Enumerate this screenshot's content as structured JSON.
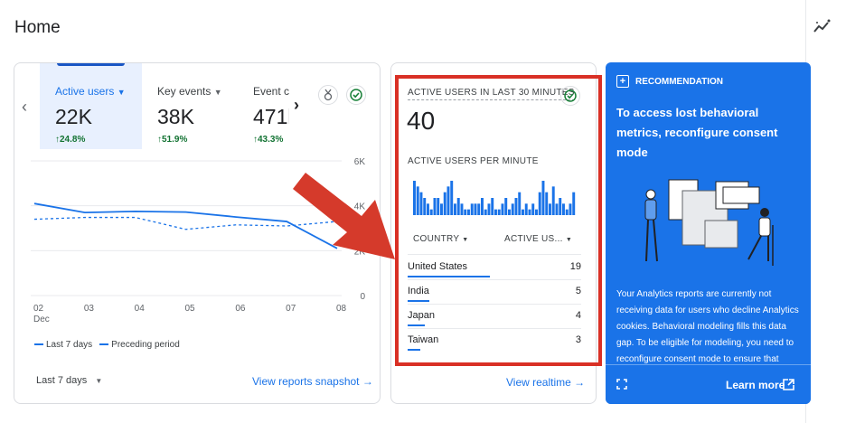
{
  "page": {
    "title": "Home"
  },
  "toolbar": {
    "insights_icon": "insights-icon"
  },
  "overview": {
    "metrics": [
      {
        "label": "Active users",
        "value": "22K",
        "change": "24.8%",
        "selected": true
      },
      {
        "label": "Key events",
        "value": "38K",
        "change": "51.9%",
        "selected": false
      },
      {
        "label": "Event c",
        "value": "471k",
        "change": "43.3%",
        "selected": false
      }
    ],
    "chart_data": {
      "type": "line",
      "x": [
        "02",
        "03",
        "04",
        "05",
        "06",
        "07",
        "08"
      ],
      "x_sublabel": "Dec",
      "ytick_labels": [
        "6K",
        "4K",
        "2K",
        "0"
      ],
      "ylim": [
        0,
        6000
      ],
      "grid": true,
      "legend_position": "bottom-left",
      "series": [
        {
          "name": "Last 7 days",
          "style": "solid",
          "values": [
            4100,
            3700,
            3750,
            3720,
            3500,
            3300,
            2100
          ]
        },
        {
          "name": "Preceding period",
          "style": "dashed",
          "values": [
            3400,
            3480,
            3480,
            2950,
            3150,
            3100,
            3300
          ]
        }
      ]
    },
    "legend": {
      "current": "Last 7 days",
      "previous": "Preceding period"
    },
    "range": "Last 7 days",
    "link": "View reports snapshot"
  },
  "realtime": {
    "title": "ACTIVE USERS IN LAST 30 MINUTES",
    "value": "40",
    "per_minute_label": "ACTIVE USERS PER MINUTE",
    "per_minute_values": [
      6,
      5,
      4,
      3,
      2,
      1,
      3,
      3,
      2,
      4,
      5,
      6,
      2,
      3,
      2,
      1,
      1,
      2,
      2,
      2,
      3,
      1,
      2,
      3,
      1,
      1,
      2,
      3,
      1,
      2,
      3,
      4,
      1,
      2,
      1,
      2,
      1,
      4,
      6,
      4,
      2,
      5,
      2,
      3,
      2,
      1,
      2,
      4
    ],
    "col_country": "COUNTRY",
    "col_users": "ACTIVE US...",
    "rows": [
      {
        "country": "United States",
        "value": "19",
        "share": 0.475
      },
      {
        "country": "India",
        "value": "5",
        "share": 0.125
      },
      {
        "country": "Japan",
        "value": "4",
        "share": 0.1
      },
      {
        "country": "Taiwan",
        "value": "3",
        "share": 0.075
      }
    ],
    "link": "View realtime"
  },
  "recommendation": {
    "label": "RECOMMENDATION",
    "title": "To access lost behavioral metrics, reconfigure consent mode",
    "body": "Your Analytics reports are currently not receiving data for users who decline Analytics cookies. Behavioral modeling fills this data gap. To be eligible for modeling, you need to reconfigure consent mode to ensure that",
    "learn_more": "Learn more"
  },
  "colors": {
    "accent": "#1a73e8",
    "highlight": "#d93025",
    "positive": "#137333"
  }
}
